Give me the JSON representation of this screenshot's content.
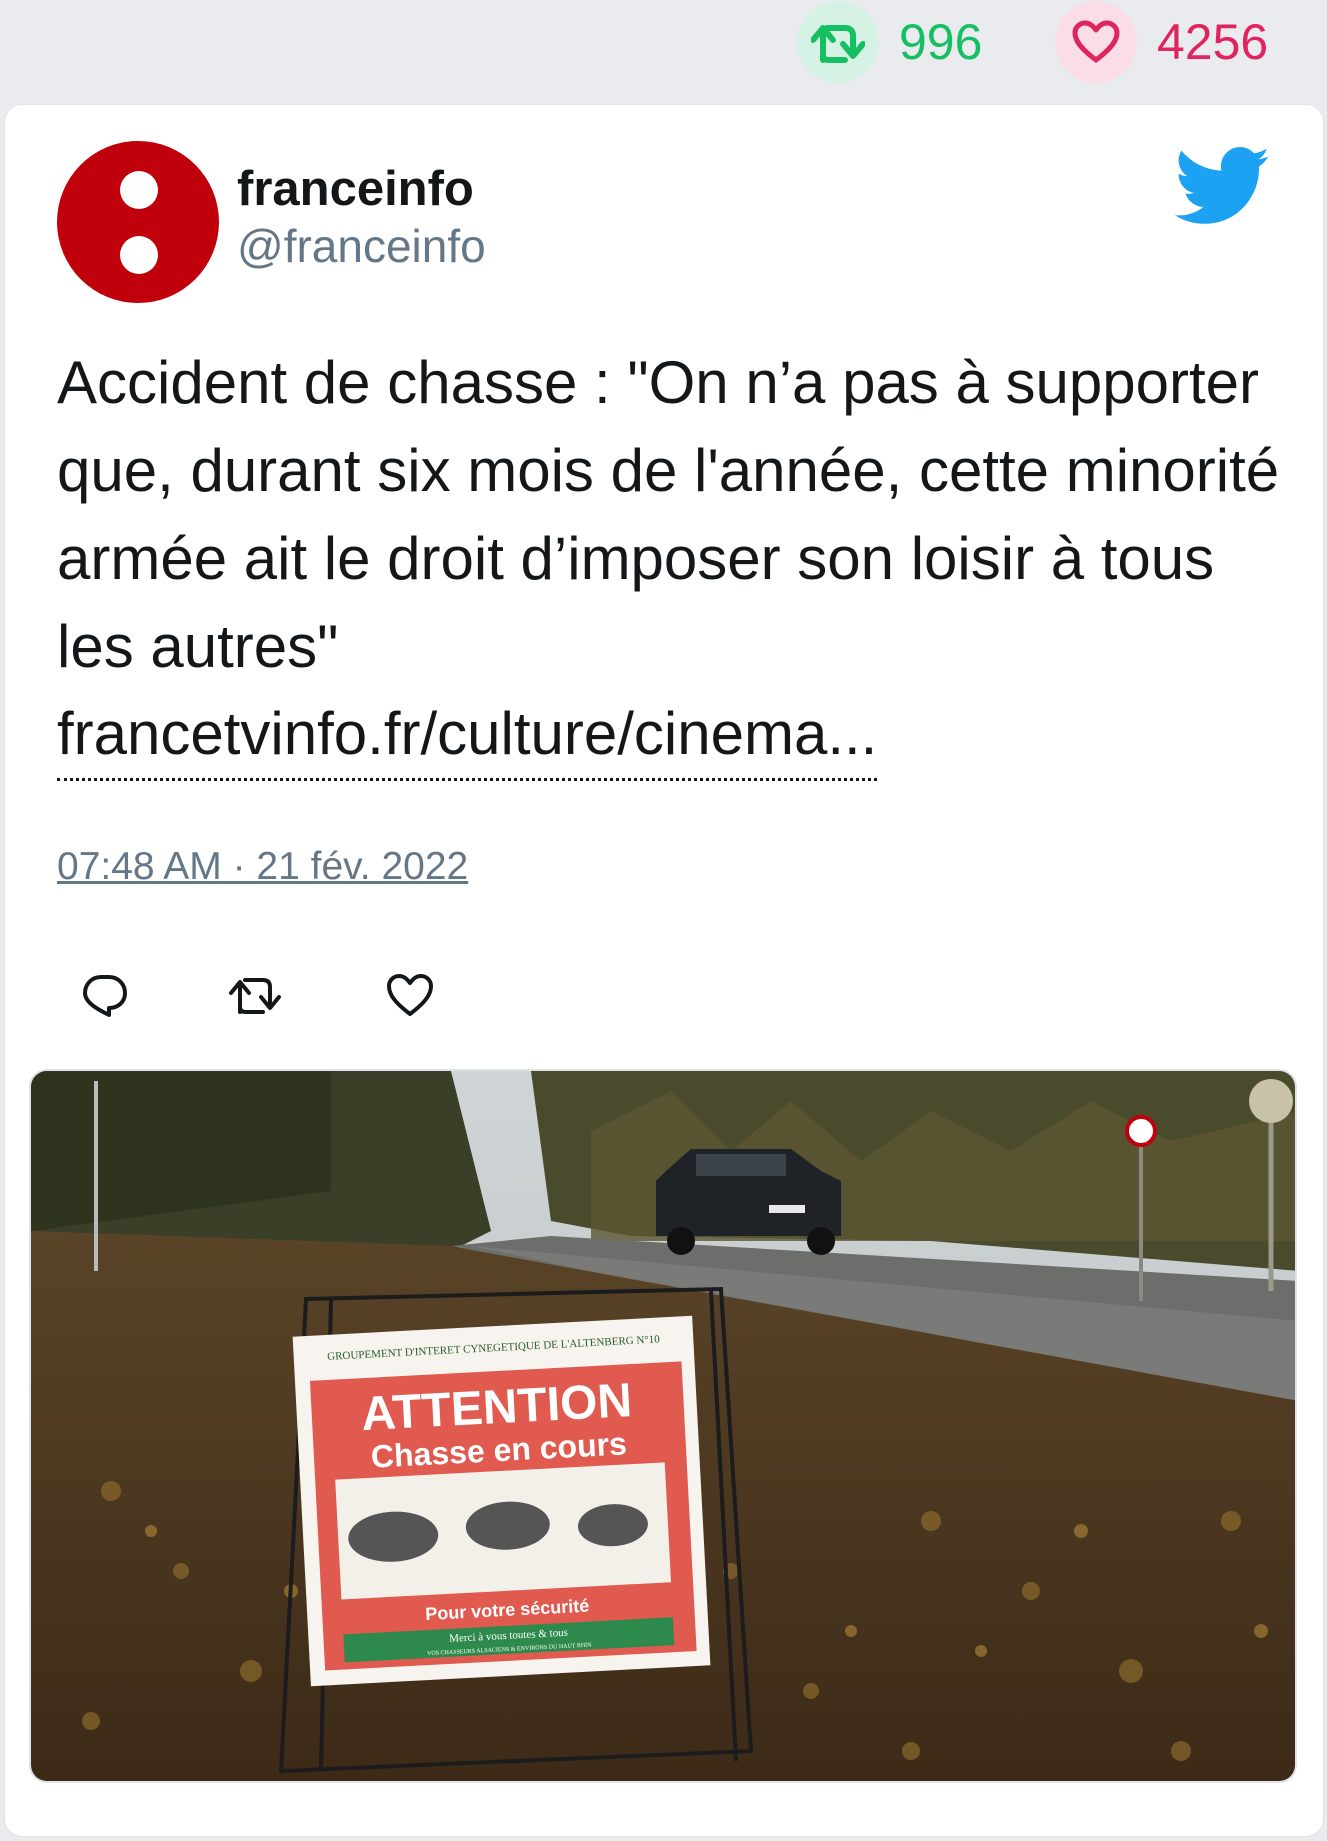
{
  "stats": {
    "retweets": "996",
    "likes": "4256",
    "retweet_icon": "retweet-icon",
    "like_icon": "heart-icon"
  },
  "tweet": {
    "display_name": "franceinfo",
    "handle": "@franceinfo",
    "text": "Accident de chasse : \"On n’a pas à supporter que, durant six mois de l'année, cette minorité armée ait le droit d’imposer son loisir à tous les autres\"",
    "link": "francetvinfo.fr/culture/cinema...",
    "timestamp": "07:48 AM · 21 fév. 2022"
  },
  "actions": {
    "reply_icon": "reply-icon",
    "retweet_icon": "retweet-icon",
    "like_icon": "heart-icon"
  },
  "media": {
    "description_icon": "photo",
    "sign_header": "GROUPEMENT D'INTERET CYNEGETIQUE DE L'ALTENBERG N°10",
    "sign_title": "ATTENTION",
    "sign_subtitle": "Chasse en cours",
    "sign_safety": "Pour votre sécurité",
    "sign_thanks": "Merci à vous toutes & tous",
    "sign_footer": "VOS CHASSEURS ALSACIENS & ENVIRONS DU HAUT RHIN"
  },
  "colors": {
    "background": "#e9ebee",
    "retweet_green": "#17bf63",
    "like_pink": "#e0245e",
    "twitter_blue": "#1da1f2",
    "avatar_red": "#c0000b",
    "secondary_text": "#657786"
  }
}
